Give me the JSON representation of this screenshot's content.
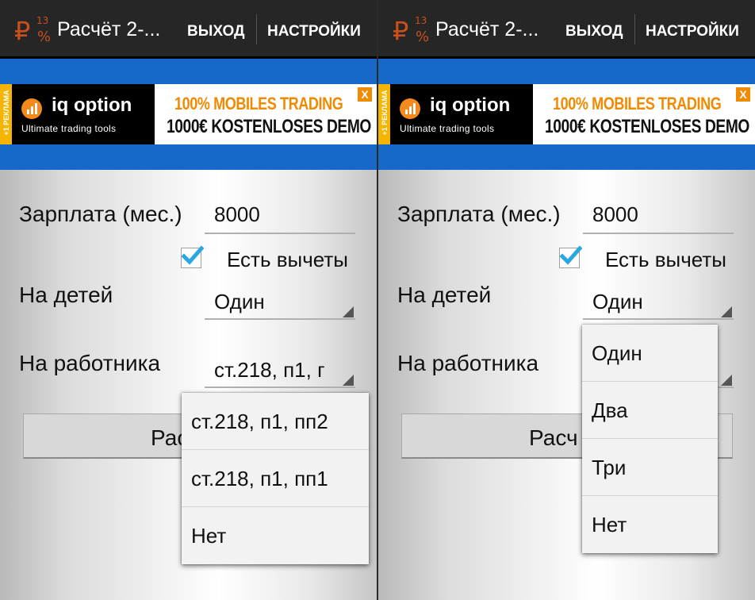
{
  "screens": [
    {
      "app_title": "Расчёт 2-...",
      "actions": {
        "exit": "ВЫХОД",
        "settings": "НАСТРОЙКИ"
      },
      "ad": {
        "tag": "+1 РЕКЛАМА",
        "brand": "iq option",
        "brand_sub": "Ultimate trading tools",
        "line1": "100% MOBILES TRADING",
        "line2": "1000€ KOSTENLOSES DEMO",
        "close": "X"
      },
      "form": {
        "salary_label": "Зарплата (мес.)",
        "salary_value": "8000",
        "deductions_label": "Есть вычеты",
        "deductions_checked": true,
        "children_label": "На детей",
        "children_value": "Один",
        "employee_label": "На работника",
        "employee_value": "ст.218, п1, г",
        "calc_button": "Рас"
      },
      "dropdown_options": [
        "ст.218, п1, пп2",
        "ст.218, п1, пп1",
        "Нет"
      ]
    },
    {
      "app_title": "Расчёт 2-...",
      "actions": {
        "exit": "ВЫХОД",
        "settings": "НАСТРОЙКИ"
      },
      "ad": {
        "tag": "+1 РЕКЛАМА",
        "brand": "iq option",
        "brand_sub": "Ultimate trading tools",
        "line1": "100% MOBILES TRADING",
        "line2": "1000€ KOSTENLOSES DEMO",
        "close": "X"
      },
      "form": {
        "salary_label": "Зарплата (мес.)",
        "salary_value": "8000",
        "deductions_label": "Есть вычеты",
        "deductions_checked": true,
        "children_label": "На детей",
        "children_value": "Один",
        "employee_label": "На работника",
        "employee_value": "",
        "calc_button": "Расч"
      },
      "dropdown_options": [
        "Один",
        "Два",
        "Три",
        "Нет"
      ]
    }
  ],
  "colors": {
    "action_bar": "#262626",
    "ad_band": "#1769c9",
    "ad_accent": "#f08a00",
    "checkbox_check": "#2aa6e0",
    "logo_accent": "#c8501e"
  }
}
